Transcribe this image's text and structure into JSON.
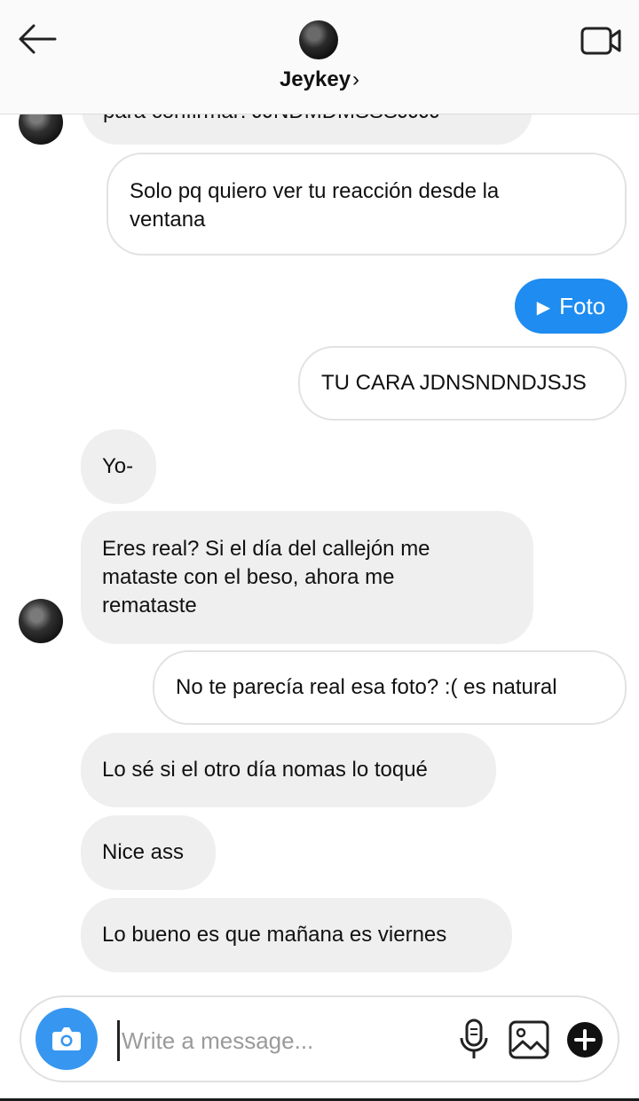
{
  "header": {
    "contact_name": "Jeykey",
    "chevron": "›",
    "back_icon": "back-arrow-icon",
    "video_icon": "video-call-icon"
  },
  "messages": [
    {
      "side": "in",
      "text": "para confirmar: JJNDMDMSSSJJJJ",
      "cropped": true
    },
    {
      "side": "out",
      "text": "Solo pq quiero ver tu reacción desde la ventana"
    },
    {
      "side": "out",
      "type": "photo",
      "text": "Foto"
    },
    {
      "side": "out",
      "text": "TU CARA JDNSNDNDJSJS"
    },
    {
      "side": "in",
      "text": "Yo-"
    },
    {
      "side": "in",
      "text": "Eres real? Si el día del callejón me mataste con el beso, ahora me remataste"
    },
    {
      "side": "out",
      "text": "No te parecía real esa foto? :( es natural"
    },
    {
      "side": "in",
      "text": "Lo sé si el otro día nomas lo toqué"
    },
    {
      "side": "in",
      "text": "Nice ass"
    },
    {
      "side": "in",
      "text": "Lo bueno es que mañana es viernes"
    }
  ],
  "composer": {
    "placeholder": "Write a message...",
    "value": "",
    "camera_icon": "camera-icon",
    "mic_icon": "microphone-icon",
    "gallery_icon": "gallery-icon",
    "plus_icon": "plus-icon"
  },
  "colors": {
    "accent": "#1e8cf0",
    "camera_button": "#3797f0",
    "incoming_bubble": "#efefef",
    "outgoing_border": "#e2e2e2"
  }
}
